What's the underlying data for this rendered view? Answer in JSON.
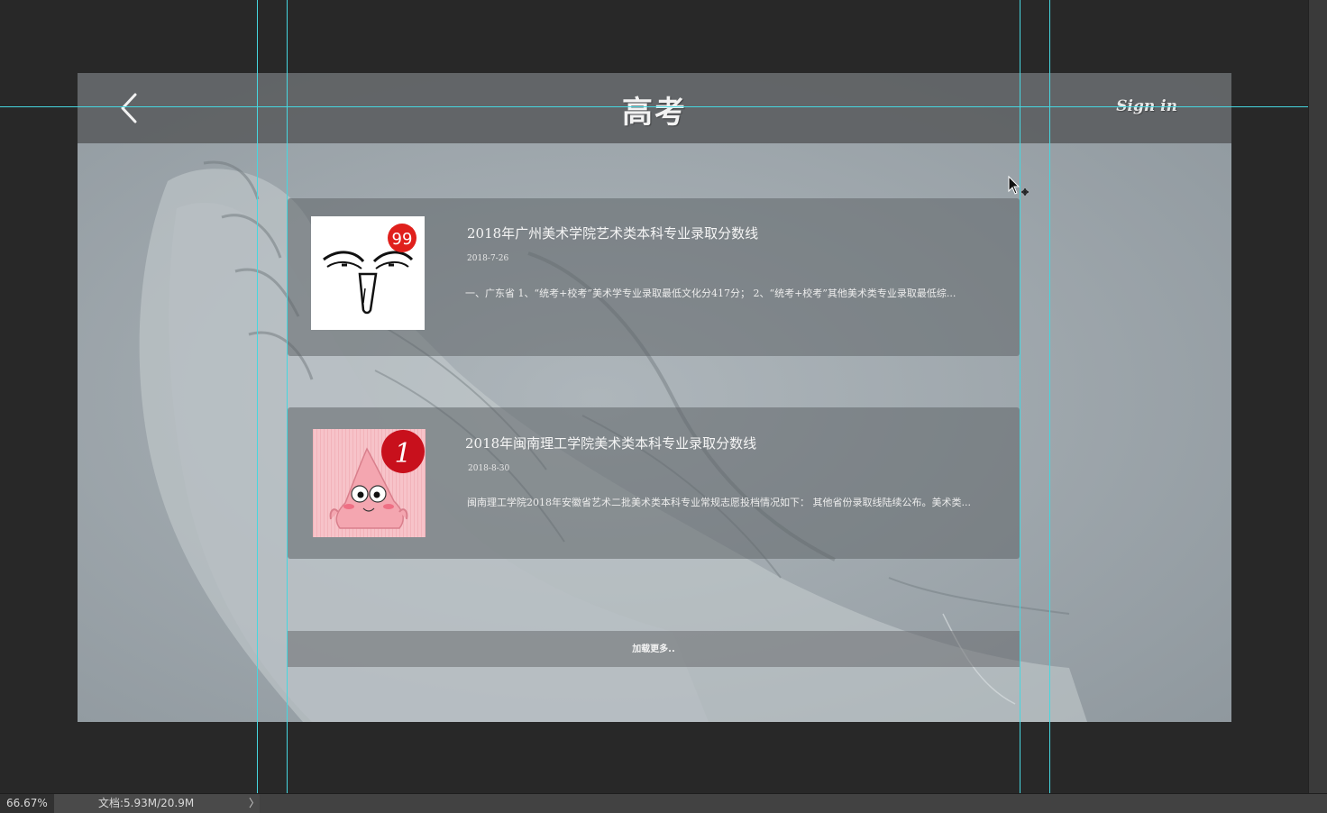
{
  "header": {
    "title": "高考",
    "sign_in_label": "Sign in"
  },
  "articles": [
    {
      "title": "2018年广州美术学院艺术类本科专业录取分数线",
      "date": "2018-7-26",
      "summary": "一、广东省 1、“统考+校考”美术学专业录取最低文化分417分； 2、“统考+校考”其他美术类专业录取最低综...",
      "thumbnail_badge": "99"
    },
    {
      "title": "2018年闽南理工学院美术类本科专业录取分数线",
      "date": "2018-8-30",
      "summary": "闽南理工学院2018年安徽省艺术二批美术类本科专业常规志愿投档情况如下： 其他省份录取线陆续公布。美术类...",
      "thumbnail_badge": "1"
    }
  ],
  "load_more_label": "加载更多..",
  "statusbar": {
    "zoom": "66.67%",
    "doc_info": "文档:5.93M/20.9M"
  },
  "colors": {
    "guide": "#46d7e0",
    "workspace": "#282828",
    "badge_red": "#e0201c"
  }
}
